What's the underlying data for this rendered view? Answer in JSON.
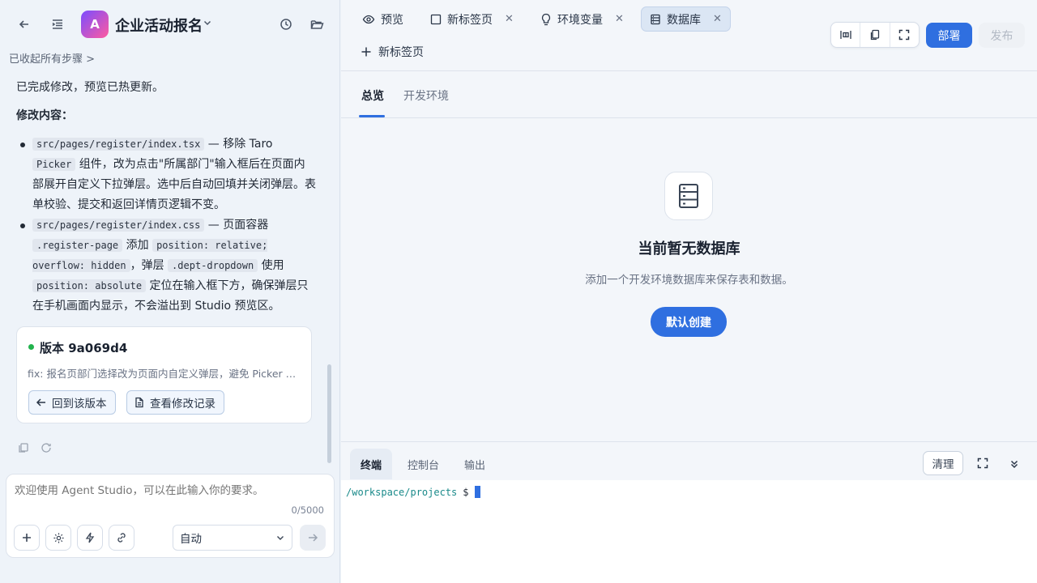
{
  "header": {
    "app_initial": "A",
    "app_title": "企业活动报名"
  },
  "chat": {
    "steps_toggle": "已收起所有步骤 >",
    "summary": "已完成修改，预览已热更新。",
    "changes_heading": "修改内容：",
    "bullet1": {
      "file": "src/pages/register/index.tsx",
      "t1": " — 移除 Taro ",
      "code2": "Picker",
      "t2": " 组件，改为点击\"所属部门\"输入框后在页面内部展开自定义下拉弹层。选中后自动回填并关闭弹层。表单校验、提交和返回详情页逻辑不变。"
    },
    "bullet2": {
      "file": "src/pages/register/index.css",
      "t1": " — 页面容器 ",
      "code2": ".register-page",
      "t2": " 添加 ",
      "code3": "position: relative; overflow: hidden",
      "t3": "，弹层 ",
      "code4": ".dept-dropdown",
      "t4": " 使用 ",
      "code5": "position: absolute",
      "t5": " 定位在输入框下方，确保弹层只在手机画面内显示，不会溢出到 Studio 预览区。"
    }
  },
  "version_card": {
    "title": "版本 9a069d4",
    "description": "fix: 报名页部门选择改为页面内自定义弹层，避免 Picker …",
    "revert_label": "回到该版本",
    "history_label": "查看修改记录",
    "status_color": "#22b34d"
  },
  "composer": {
    "placeholder": "欢迎使用 Agent Studio，可以在此输入你的要求。",
    "count": "0/5000",
    "mode": "自动"
  },
  "tabs": [
    {
      "label": "预览",
      "icon": "eye-icon"
    },
    {
      "label": "新标签页",
      "icon": "square-icon"
    },
    {
      "label": "环境变量",
      "icon": "bulb-icon"
    },
    {
      "label": "数据库",
      "icon": "database-icon"
    }
  ],
  "new_tab_label": "新标签页",
  "actions": {
    "deploy": "部署",
    "publish": "发布"
  },
  "subtabs": [
    "总览",
    "开发环境"
  ],
  "empty_state": {
    "title": "当前暂无数据库",
    "description": "添加一个开发环境数据库来保存表和数据。",
    "create_label": "默认创建"
  },
  "terminal": {
    "tabs": [
      "终端",
      "控制台",
      "输出"
    ],
    "clear_label": "清理",
    "prompt_path": "/workspace/projects",
    "prompt_symbol": "$"
  },
  "colors": {
    "accent": "#2f6fe0",
    "background": "#eef3f9"
  }
}
